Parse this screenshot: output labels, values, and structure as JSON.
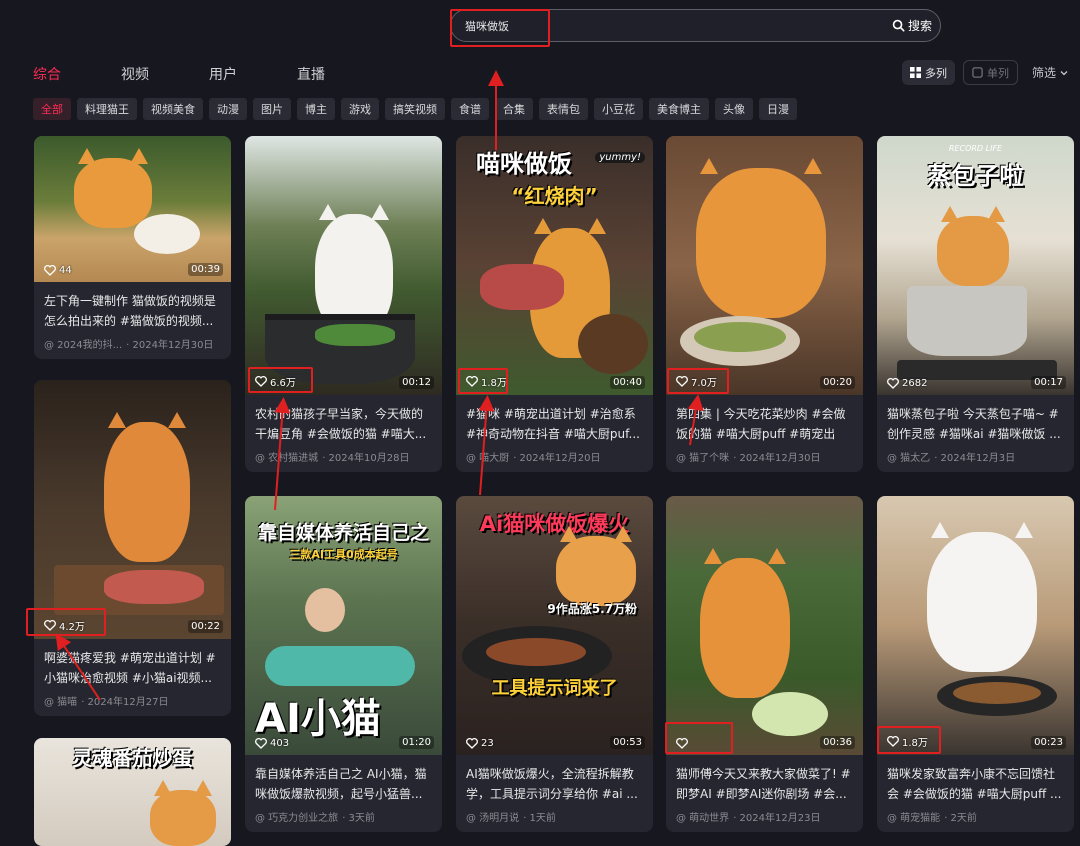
{
  "search": {
    "value": "猫咪做饭",
    "button_label": "搜索"
  },
  "tabs": [
    {
      "label": "综合",
      "active": true
    },
    {
      "label": "视频",
      "active": false
    },
    {
      "label": "用户",
      "active": false
    },
    {
      "label": "直播",
      "active": false
    }
  ],
  "view": {
    "multi_label": "多列",
    "single_label": "单列",
    "filter_label": "筛选"
  },
  "chips": [
    "全部",
    "料理猫王",
    "视频美食",
    "动漫",
    "图片",
    "博主",
    "游戏",
    "搞笑视频",
    "食谱",
    "合集",
    "表情包",
    "小豆花",
    "美食博主",
    "头像",
    "日漫"
  ],
  "cards": [
    {
      "likes": "44",
      "duration": "00:39",
      "desc": "左下角一键制作 猫做饭的视频是怎么拍出来的 #猫做饭的视频...",
      "author": "@ 2024我的抖...",
      "date": "· 2024年12月30日"
    },
    {
      "likes": "4.2万",
      "duration": "00:22",
      "desc": "啊婆猫疼爱我 #萌宠出道计划 #小猫咪治愈视频 #小猫ai视频...",
      "author": "@ 猫喵",
      "date": "· 2024年12月27日"
    },
    {
      "overlay": "灵魂番茄炒蛋"
    },
    {
      "likes": "6.6万",
      "duration": "00:12",
      "desc": "农村的猫孩子早当家，今天做的干煸豆角 #会做饭的猫 #喵大...",
      "author": "@ 农村猫进城",
      "date": "· 2024年10月28日"
    },
    {
      "likes": "403",
      "duration": "01:20",
      "overlay": "靠自媒体养活自己之",
      "overlay_sub": "三款AI工具0成本起号",
      "overlay_big": "AI小猫",
      "desc": "靠自媒体养活自己之 AI小猫，猫咪做饭爆款视频，起号小猛兽...",
      "author": "@ 巧克力创业之旅",
      "date": "· 3天前"
    },
    {
      "likes": "1.8万",
      "duration": "00:40",
      "overlay": "喵咪做饭",
      "overlay_tag": "yummy!",
      "overlay_sub": "“红烧肉”",
      "desc": "#猫咪 #萌宠出道计划 #治愈系 #神奇动物在抖音 #喵大厨puf...",
      "author": "@ 喵大厨",
      "date": "· 2024年12月20日"
    },
    {
      "likes": "23",
      "duration": "00:53",
      "overlay": "Ai猫咪做饭爆火",
      "overlay_sub": "9作品涨5.7万粉",
      "overlay_big": "工具提示词来了",
      "desc": "AI猫咪做饭爆火，全流程拆解教学，工具提示词分享给你 #ai ...",
      "author": "@ 汤明月说",
      "date": "· 1天前"
    },
    {
      "likes": "7.0万",
      "duration": "00:20",
      "desc": "第四集 | 今天吃花菜炒肉 #会做饭的猫 #喵大厨puff #萌宠出道...",
      "author": "@ 猫了个咪",
      "date": "· 2024年12月30日"
    },
    {
      "likes": "",
      "duration": "00:36",
      "desc": "猫师傅今天又来教大家做菜了! #即梦AI #即梦AI迷你剧场 #会...",
      "author": "@ 萌动世界",
      "date": "· 2024年12月23日"
    },
    {
      "likes": "2682",
      "duration": "00:17",
      "overlay_tag": "RECORD LIFE",
      "overlay": "蒸包子啦",
      "desc": "猫咪蒸包子啦 今天蒸包子喵~ #创作灵感 #猫咪ai #猫咪做饭 ...",
      "author": "@ 猫太乙",
      "date": "· 2024年12月3日"
    },
    {
      "likes": "1.8万",
      "duration": "00:23",
      "desc": "猫咪发家致富奔小康不忘回馈社会 #会做饭的猫 #喵大厨puff ...",
      "author": "@ 萌宠猫能",
      "date": "· 2天前"
    }
  ],
  "colors": {
    "accent": "#fe2c55",
    "annotation": "#e02020",
    "background": "#16171f",
    "card": "#25262f"
  }
}
